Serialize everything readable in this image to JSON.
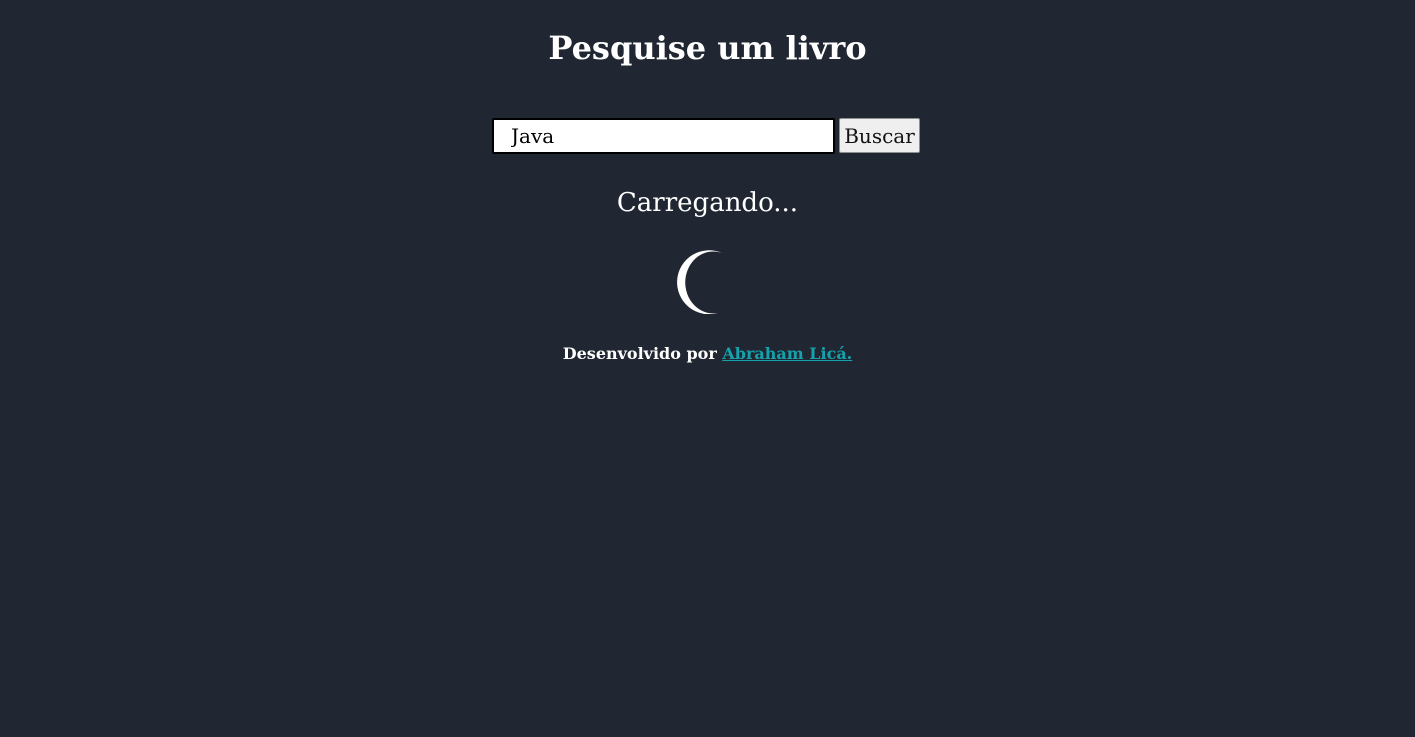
{
  "header": {
    "title": "Pesquise um livro"
  },
  "search": {
    "value": "Java",
    "button_label": "Buscar"
  },
  "status": {
    "loading_text": "Carregando..."
  },
  "footer": {
    "prefix": "Desenvolvido por ",
    "author_link": "Abraham Licá."
  },
  "colors": {
    "background": "#212732",
    "text": "#ffffff",
    "link": "#14a3ac",
    "spinner": "#ffffff"
  },
  "icons": {
    "spinner": "loading-spinner-icon"
  }
}
